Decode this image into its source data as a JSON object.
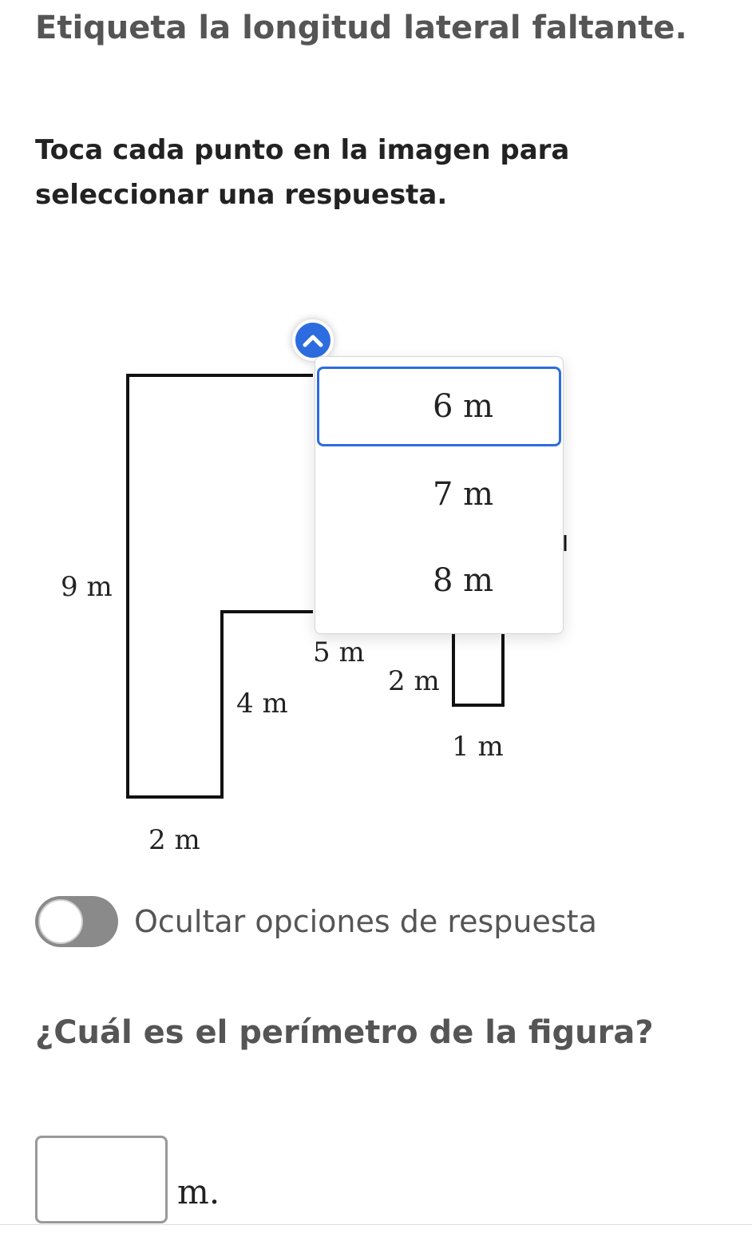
{
  "title": "Etiqueta la longitud lateral faltante.",
  "instruction": "Toca cada punto en la imagen para seleccionar una respuesta.",
  "figure": {
    "labels": {
      "left": "9 m",
      "bottom": "2 m",
      "inner_vertical": "4 m",
      "inner_top": "5 m",
      "step_vertical": "2 m",
      "step_bottom": "1 m"
    }
  },
  "dropdown": {
    "icon": "chevron-up-icon",
    "options": [
      "6 m",
      "7 m",
      "8 m"
    ],
    "selected": "6 m"
  },
  "toggle": {
    "label": "Ocultar opciones de respuesta"
  },
  "question": "¿Cuál es el perímetro de la figura?",
  "answer": {
    "value": "",
    "unit": "m."
  },
  "colors": {
    "accent": "#2d6cdf",
    "toggle_track": "#8a8a8a"
  }
}
